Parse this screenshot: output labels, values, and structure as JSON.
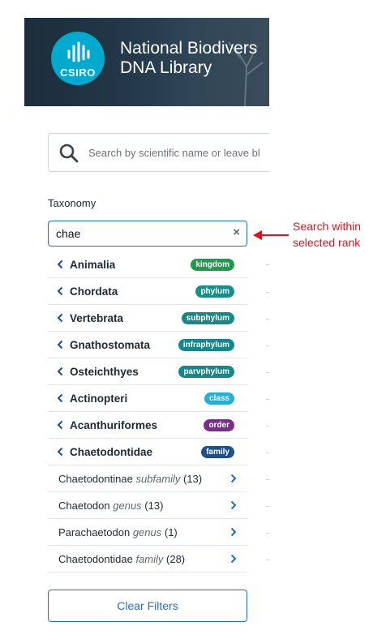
{
  "banner": {
    "logo_text": "CSIRO",
    "title_line1": "National Biodivers",
    "title_line2": "DNA Library"
  },
  "search": {
    "placeholder": "Search by scientific name or leave bl"
  },
  "taxonomy": {
    "label": "Taxonomy",
    "query": "chae",
    "clear_symbol": "×"
  },
  "annotation": {
    "line1": "Search within",
    "line2": "selected rank",
    "color": "#e0101a"
  },
  "ranks": [
    {
      "name": "Animalia",
      "rank": "kingdom",
      "color": "#1e9a4f"
    },
    {
      "name": "Chordata",
      "rank": "phylum",
      "color": "#14908a"
    },
    {
      "name": "Vertebrata",
      "rank": "subphylum",
      "color": "#148a84"
    },
    {
      "name": "Gnathostomata",
      "rank": "infraphylum",
      "color": "#138789"
    },
    {
      "name": "Osteichthyes",
      "rank": "parvphylum",
      "color": "#138989"
    },
    {
      "name": "Actinopteri",
      "rank": "class",
      "color": "#27aed3"
    },
    {
      "name": "Acanthuriformes",
      "rank": "order",
      "color": "#7b2d8e"
    },
    {
      "name": "Chaetodontidae",
      "rank": "family",
      "color": "#1f4f8a"
    }
  ],
  "children": [
    {
      "name": "Chaetodontinae",
      "rank": "subfamily",
      "count": "(13)"
    },
    {
      "name": "Chaetodon",
      "rank": "genus",
      "count": "(13)"
    },
    {
      "name": "Parachaetodon",
      "rank": "genus",
      "count": "(1)"
    },
    {
      "name": "Chaetodontidae",
      "rank": "family",
      "count": "(28)"
    }
  ],
  "clear_filters_label": "Clear Filters",
  "colors": {
    "accent": "#1f6fbf",
    "banner_bg": "#1c2d3a",
    "logo": "#00a9ce"
  }
}
